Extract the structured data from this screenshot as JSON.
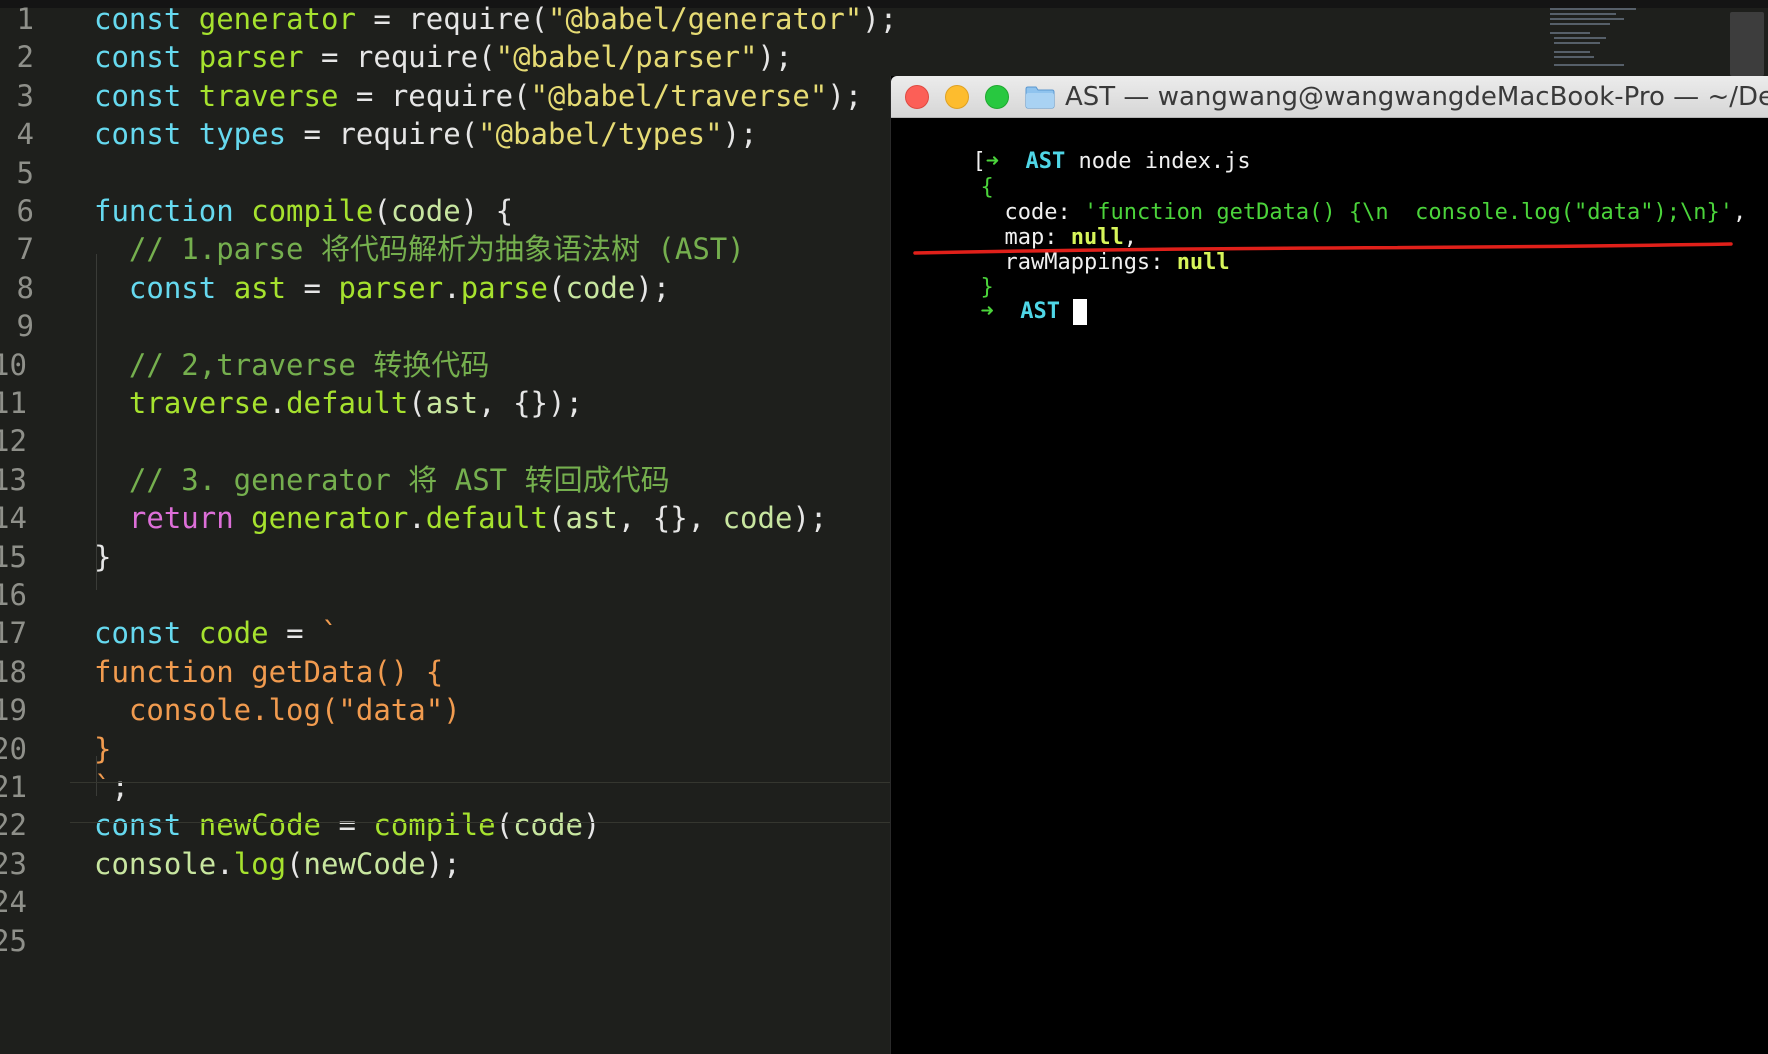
{
  "editor": {
    "line_numbers": [
      "1",
      "2",
      "3",
      "4",
      "5",
      "6",
      "7",
      "8",
      "9",
      "10",
      "11",
      "12",
      "13",
      "14",
      "15",
      "16",
      "17",
      "18",
      "19",
      "20",
      "21",
      "22",
      "23",
      "24",
      "25"
    ],
    "lines": [
      [
        {
          "t": "const ",
          "c": "kw"
        },
        {
          "t": "generator",
          "c": "var"
        },
        {
          "t": " = ",
          "c": "op"
        },
        {
          "t": "require",
          "c": "call"
        },
        {
          "t": "(",
          "c": "op"
        },
        {
          "t": "\"@babel/generator\"",
          "c": "str"
        },
        {
          "t": ");",
          "c": "op"
        }
      ],
      [
        {
          "t": "const ",
          "c": "kw"
        },
        {
          "t": "parser",
          "c": "var"
        },
        {
          "t": " = ",
          "c": "op"
        },
        {
          "t": "require",
          "c": "call"
        },
        {
          "t": "(",
          "c": "op"
        },
        {
          "t": "\"@babel/parser\"",
          "c": "str"
        },
        {
          "t": ");",
          "c": "op"
        }
      ],
      [
        {
          "t": "const ",
          "c": "kw"
        },
        {
          "t": "traverse",
          "c": "var"
        },
        {
          "t": " = ",
          "c": "op"
        },
        {
          "t": "require",
          "c": "call"
        },
        {
          "t": "(",
          "c": "op"
        },
        {
          "t": "\"@babel/traverse\"",
          "c": "str"
        },
        {
          "t": ");",
          "c": "op"
        }
      ],
      [
        {
          "t": "const ",
          "c": "kw"
        },
        {
          "t": "types",
          "c": "kw"
        },
        {
          "t": " = ",
          "c": "op"
        },
        {
          "t": "require",
          "c": "call"
        },
        {
          "t": "(",
          "c": "op"
        },
        {
          "t": "\"@babel/types\"",
          "c": "str"
        },
        {
          "t": ");",
          "c": "op"
        }
      ],
      [],
      [
        {
          "t": "function ",
          "c": "kw"
        },
        {
          "t": "compile",
          "c": "id"
        },
        {
          "t": "(",
          "c": "op"
        },
        {
          "t": "code",
          "c": "prop"
        },
        {
          "t": ") {",
          "c": "op"
        }
      ],
      [
        {
          "t": "  // 1.parse 将代码解析为抽象语法树 (AST)",
          "c": "cmt"
        }
      ],
      [
        {
          "t": "  const ",
          "c": "kw"
        },
        {
          "t": "ast",
          "c": "var"
        },
        {
          "t": " = ",
          "c": "op"
        },
        {
          "t": "parser",
          "c": "var"
        },
        {
          "t": ".",
          "c": "op"
        },
        {
          "t": "parse",
          "c": "var"
        },
        {
          "t": "(",
          "c": "op"
        },
        {
          "t": "code",
          "c": "prop"
        },
        {
          "t": ");",
          "c": "op"
        }
      ],
      [],
      [
        {
          "t": "  // 2,traverse 转换代码",
          "c": "cmt"
        }
      ],
      [
        {
          "t": "  traverse",
          "c": "var"
        },
        {
          "t": ".",
          "c": "op"
        },
        {
          "t": "default",
          "c": "var"
        },
        {
          "t": "(",
          "c": "op"
        },
        {
          "t": "ast",
          "c": "prop"
        },
        {
          "t": ", {});",
          "c": "op"
        }
      ],
      [],
      [
        {
          "t": "  // 3. generator 将 AST 转回成代码",
          "c": "cmt"
        }
      ],
      [
        {
          "t": "  return ",
          "c": "ret-kw"
        },
        {
          "t": "generator",
          "c": "var"
        },
        {
          "t": ".",
          "c": "op"
        },
        {
          "t": "default",
          "c": "var"
        },
        {
          "t": "(",
          "c": "op"
        },
        {
          "t": "ast",
          "c": "prop"
        },
        {
          "t": ", {}, ",
          "c": "op"
        },
        {
          "t": "code",
          "c": "prop"
        },
        {
          "t": ");",
          "c": "op"
        }
      ],
      [
        {
          "t": "}",
          "c": "op"
        }
      ],
      [],
      [
        {
          "t": "const ",
          "c": "kw"
        },
        {
          "t": "code",
          "c": "var"
        },
        {
          "t": " = ",
          "c": "op"
        },
        {
          "t": "`",
          "c": "tmpl"
        }
      ],
      [
        {
          "t": "function getData() {",
          "c": "tmpl"
        }
      ],
      [
        {
          "t": "  console.log(\"data\")",
          "c": "tmpl"
        }
      ],
      [
        {
          "t": "}",
          "c": "tmpl"
        }
      ],
      [
        {
          "t": "`",
          "c": "tmpl"
        },
        {
          "t": ";",
          "c": "op"
        }
      ],
      [
        {
          "t": "const ",
          "c": "kw"
        },
        {
          "t": "newCode",
          "c": "var"
        },
        {
          "t": " = ",
          "c": "op"
        },
        {
          "t": "compile",
          "c": "id"
        },
        {
          "t": "(",
          "c": "op"
        },
        {
          "t": "code",
          "c": "prop"
        },
        {
          "t": ")",
          "c": "op"
        }
      ],
      [
        {
          "t": "console",
          "c": "prop"
        },
        {
          "t": ".",
          "c": "op"
        },
        {
          "t": "log",
          "c": "var"
        },
        {
          "t": "(",
          "c": "op"
        },
        {
          "t": "newCode",
          "c": "prop"
        },
        {
          "t": ");",
          "c": "op"
        }
      ],
      [],
      []
    ]
  },
  "terminal": {
    "title": "AST — wangwang@wangwangdeMacBook-Pro — ~/Desktop",
    "prompt_arrow": "➜",
    "prompt_dir": "AST",
    "command": "node index.js",
    "open_brace": "{",
    "code_key": "code",
    "code_value": "'function getData() {\\n  console.log(\"data\");\\n}'",
    "map_key": "map",
    "map_value": "null",
    "raw_key": "rawMappings",
    "raw_value": "null",
    "close_brace": "}",
    "prompt2_dir": "AST"
  }
}
